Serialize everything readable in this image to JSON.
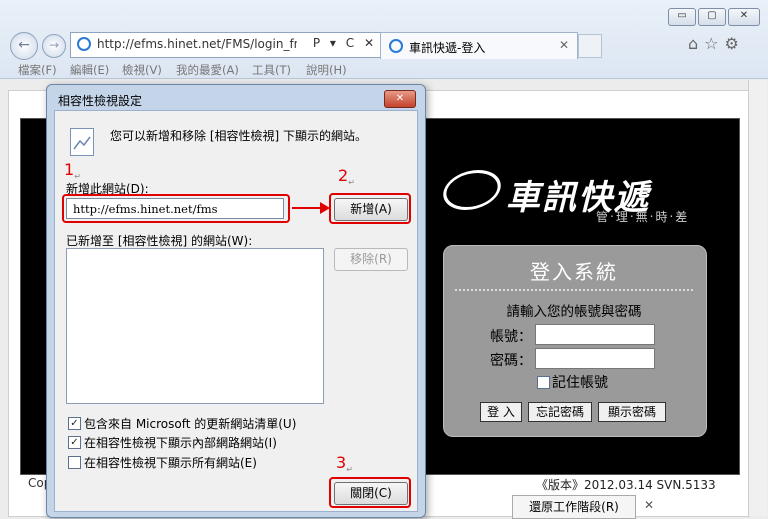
{
  "browser": {
    "address_url": "http://efms.hinet.net/FMS/login_fms.as",
    "address_tools": "P ▾ C ✕",
    "tab_title": "車訊快遞-登入",
    "tab_close": "✕",
    "window_controls": {
      "minimize": "▭",
      "maximize": "▢",
      "close": "✕"
    },
    "nav_back": "←",
    "nav_forward": "→",
    "right_icons": "⌂☆⚙",
    "menu": [
      "檔案(F)",
      "編輯(E)",
      "檢視(V)",
      "我的最愛(A)",
      "工具(T)",
      "說明(H)"
    ]
  },
  "page": {
    "logo_text": "車訊快遞",
    "logo_subtitle": "管‧理‧無‧時‧差",
    "login": {
      "title": "登入系統",
      "prompt": "請輸入您的帳號與密碼",
      "account_label": "帳號：",
      "password_label": "密碼：",
      "remember_label": "記住帳號",
      "login_button": "登 入",
      "forgot_button": "忘記密碼",
      "show_button": "顯示密碼"
    },
    "copyright_prefix": "Cop",
    "version": "《版本》2012.03.14 SVN.5133",
    "restore_button": "還原工作階段(R)",
    "restore_close": "✕"
  },
  "dialog": {
    "title": "相容性檢視設定",
    "close": "✕",
    "description": "您可以新增和移除 [相容性檢視] 下顯示的網站。",
    "add_label": "新增此網站(D):",
    "url_value": "http://efms.hinet.net/fms",
    "add_button": "新增(A)",
    "list_label": "已新增至 [相容性檢視] 的網站(W):",
    "remove_button": "移除(R)",
    "checkboxes": [
      {
        "label": "包含來自 Microsoft 的更新網站清單(U)",
        "mark": "✓"
      },
      {
        "label": "在相容性檢視下顯示內部網路網站(I)",
        "mark": "✓"
      },
      {
        "label": "在相容性檢視下顯示所有網站(E)",
        "mark": ""
      }
    ],
    "close_button": "關閉(C)"
  },
  "annotations": {
    "step1": "1",
    "step2": "2",
    "step3": "3",
    "mark": "↵",
    "color": "#e00000"
  }
}
